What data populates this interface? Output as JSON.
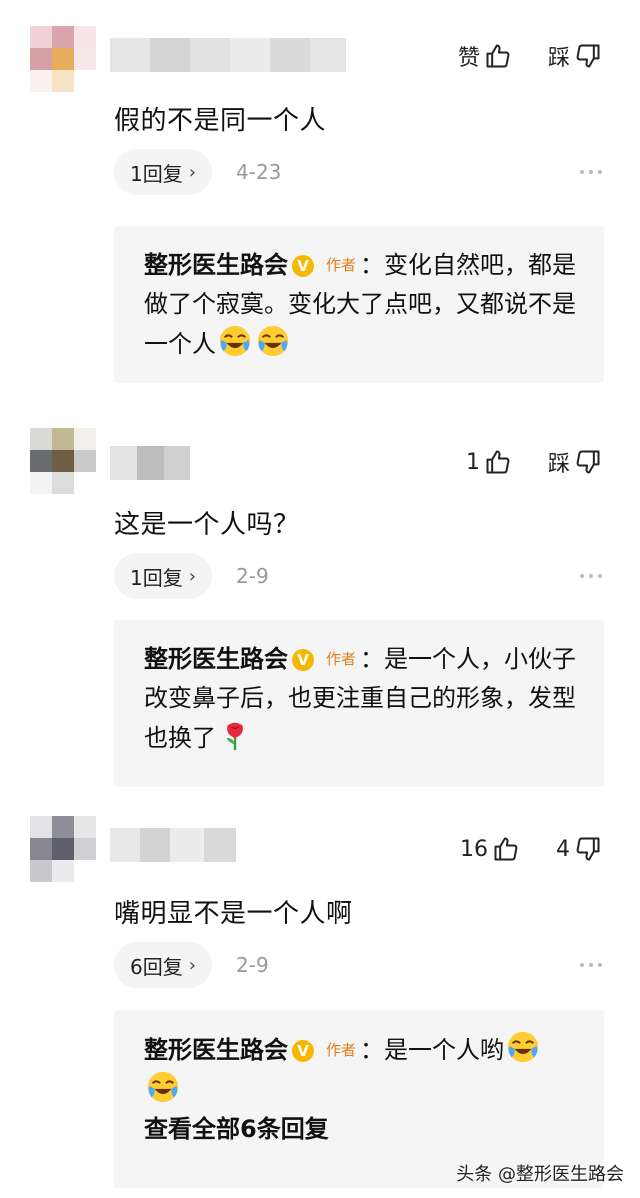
{
  "comments": [
    {
      "like_label": "赞",
      "dislike_label": "踩",
      "text": "假的不是同一个人",
      "reply_count": "1回复",
      "date": "4-23",
      "reply": {
        "author": "整形医生路会",
        "badge": "V",
        "tag": "作者",
        "text": "：变化自然吧，都是做了个寂寞。变化大了点吧，又都说不是一个人",
        "emojis": [
          "crying-laugh-emoji",
          "crying-laugh-emoji"
        ]
      }
    },
    {
      "like_label": "1",
      "dislike_label": "踩",
      "text": "这是一个人吗？",
      "reply_count": "1回复",
      "date": "2-9",
      "reply": {
        "author": "整形医生路会",
        "badge": "V",
        "tag": "作者",
        "text": "：是一个人，小伙子改变鼻子后，也更注重自己的形象，发型也换了",
        "emojis": [
          "rose-emoji"
        ]
      }
    },
    {
      "like_label": "16",
      "dislike_label": "4",
      "text": "嘴明显不是一个人啊",
      "reply_count": "6回复",
      "date": "2-9",
      "reply": {
        "author": "整形医生路会",
        "badge": "V",
        "tag": "作者",
        "text": "：是一个人哟",
        "emojis": [
          "crying-laugh-emoji",
          "crying-laugh-emoji"
        ],
        "see_all": "查看全部6条回复"
      }
    }
  ],
  "watermark": "头条 @整形医生路会",
  "colors": {
    "accent_badge": "#f5b800",
    "author_tag": "#e0801a",
    "reply_bg": "#f5f5f5"
  }
}
